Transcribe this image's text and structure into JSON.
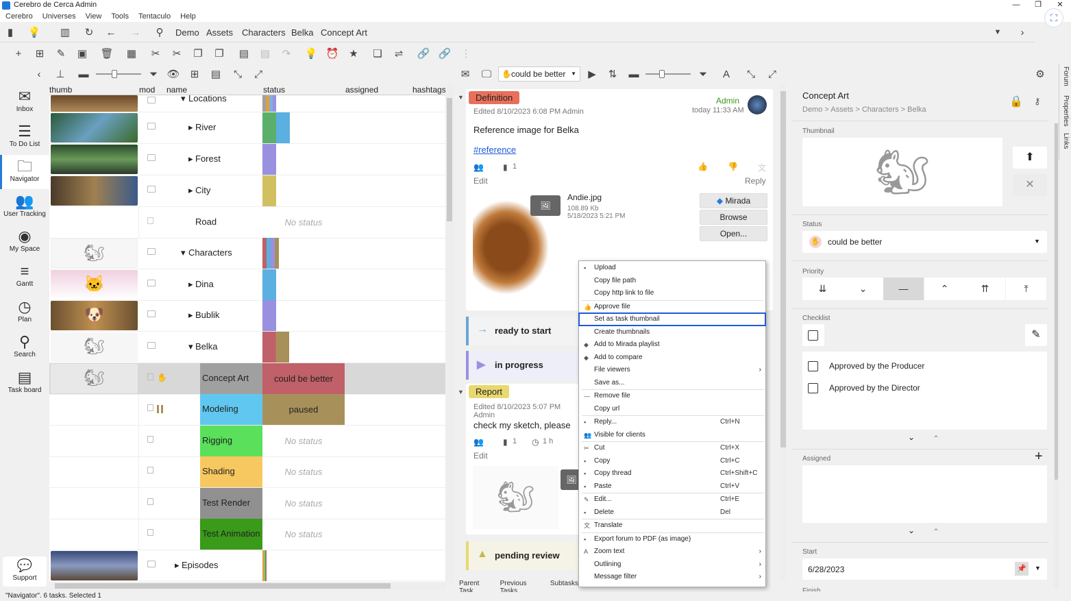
{
  "window": {
    "title": "Cerebro de Cerca  Admin"
  },
  "menu": [
    "Cerebro",
    "Universes",
    "View",
    "Tools",
    "Tentaculo",
    "Help"
  ],
  "breadcrumb": [
    "Demo",
    "Assets",
    "Characters",
    "Belka",
    "Concept Art"
  ],
  "nav": [
    {
      "label": "Inbox",
      "icon": "inbox-icon",
      "glyph": "✉"
    },
    {
      "label": "To Do List",
      "icon": "list-icon",
      "glyph": "☰"
    },
    {
      "label": "Navigator",
      "icon": "folder-icon",
      "glyph": "🗀"
    },
    {
      "label": "User Tracking",
      "icon": "users-icon",
      "glyph": "👥"
    },
    {
      "label": "My Space",
      "icon": "globe-icon",
      "glyph": "◉"
    },
    {
      "label": "Gantt",
      "icon": "gantt-icon",
      "glyph": "≡"
    },
    {
      "label": "Plan",
      "icon": "plan-icon",
      "glyph": "◷"
    },
    {
      "label": "Search",
      "icon": "search-icon",
      "glyph": "⚲"
    },
    {
      "label": "Task board",
      "icon": "clipboard-icon",
      "glyph": "▤"
    }
  ],
  "support": "Support",
  "columns": [
    "thumb",
    "mod",
    "name",
    "status",
    "assigned",
    "hashtags"
  ],
  "rows": [
    {
      "name": "Locations",
      "arrow": "▾",
      "status": "",
      "thumb": "#a08050"
    },
    {
      "name": "River",
      "arrow": "▸",
      "status": "",
      "thumb": "#4a8a6a"
    },
    {
      "name": "Forest",
      "arrow": "▸",
      "status": "",
      "thumb": "#3a6a3a"
    },
    {
      "name": "City",
      "arrow": "▸",
      "status": "",
      "thumb": "#6a5a3a"
    },
    {
      "name": "Road",
      "arrow": "",
      "status": "No status",
      "thumb": ""
    },
    {
      "name": "Characters",
      "arrow": "▾",
      "status": "",
      "thumb": "#d8d8d8"
    },
    {
      "name": "Dina",
      "arrow": "▸",
      "status": "",
      "thumb": "#e8c0d0"
    },
    {
      "name": "Bublik",
      "arrow": "▸",
      "status": "",
      "thumb": "#8a6a3a"
    },
    {
      "name": "Belka",
      "arrow": "▾",
      "status": "",
      "thumb": "#d8d8d8"
    },
    {
      "name": "Concept Art",
      "arrow": "",
      "status": "could be better",
      "thumb": "#d0d0d0"
    },
    {
      "name": "Modeling",
      "arrow": "",
      "status": "paused",
      "thumb": ""
    },
    {
      "name": "Rigging",
      "arrow": "",
      "status": "No status",
      "thumb": ""
    },
    {
      "name": "Shading",
      "arrow": "",
      "status": "No status",
      "thumb": ""
    },
    {
      "name": "Test Render",
      "arrow": "",
      "status": "No status",
      "thumb": ""
    },
    {
      "name": "Test Animation",
      "arrow": "",
      "status": "No status",
      "thumb": ""
    },
    {
      "name": "Episodes",
      "arrow": "▸",
      "status": "",
      "thumb": "#5a6a8a"
    }
  ],
  "forum_toolbar": {
    "status": "could be better"
  },
  "definition": {
    "tag": "Definition",
    "author": "Admin",
    "time": "today 11:33 AM",
    "edited": "Edited 8/10/2023 6:08 PM  Admin",
    "text": "Reference image for Belka",
    "hashtag": "#reference",
    "files_count": "1",
    "edit": "Edit",
    "reply": "Reply",
    "file": {
      "name": "Andie.jpg",
      "size": "108.89 Kb",
      "date": "5/18/2023 5:21 PM"
    },
    "buttons": [
      "Mirada",
      "Browse",
      "Open..."
    ]
  },
  "status_cards": [
    "ready to start",
    "in progress",
    "pending review"
  ],
  "report": {
    "tag": "Report",
    "edited": "Edited 8/10/2023 5:07 PM  Admin",
    "text": "check my sketch, please",
    "files_count": "1",
    "time_spent": "1 h",
    "edit": "Edit"
  },
  "bottom_tabs": [
    "Parent Task",
    "Previous Tasks",
    "Subtasks"
  ],
  "context_menu": [
    {
      "label": "Upload",
      "shortcut": "",
      "icon": "▪"
    },
    {
      "label": "Copy file path",
      "shortcut": ""
    },
    {
      "label": "Copy http link to file",
      "shortcut": ""
    },
    {
      "sep": true
    },
    {
      "label": "Approve file",
      "shortcut": "",
      "icon": "👍"
    },
    {
      "label": "Set as task thumbnail",
      "shortcut": "",
      "highlight": true
    },
    {
      "label": "Create thumbnails",
      "shortcut": ""
    },
    {
      "label": "Add to Mirada playlist",
      "shortcut": "",
      "icon": "◆"
    },
    {
      "label": "Add to compare",
      "shortcut": "",
      "icon": "◆"
    },
    {
      "label": "File viewers",
      "shortcut": "",
      "submenu": true
    },
    {
      "label": "Save as...",
      "shortcut": ""
    },
    {
      "sep": true
    },
    {
      "label": "Remove file",
      "shortcut": "",
      "icon": "—"
    },
    {
      "label": "Copy url",
      "shortcut": ""
    },
    {
      "sep": true
    },
    {
      "label": "Reply...",
      "shortcut": "Ctrl+N",
      "icon": "▪"
    },
    {
      "label": "Visible for clients",
      "shortcut": "",
      "icon": "👥"
    },
    {
      "sep": true
    },
    {
      "label": "Cut",
      "shortcut": "Ctrl+X",
      "icon": "✂"
    },
    {
      "label": "Copy",
      "shortcut": "Ctrl+C",
      "icon": "▪"
    },
    {
      "label": "Copy thread",
      "shortcut": "Ctrl+Shift+C",
      "icon": "▪"
    },
    {
      "label": "Paste",
      "shortcut": "Ctrl+V",
      "icon": "▪"
    },
    {
      "sep": true
    },
    {
      "label": "Edit...",
      "shortcut": "Ctrl+E",
      "icon": "✎"
    },
    {
      "label": "Delete",
      "shortcut": "Del",
      "icon": "▪"
    },
    {
      "sep": true
    },
    {
      "label": "Translate",
      "shortcut": "",
      "icon": "文"
    },
    {
      "sep": true
    },
    {
      "label": "Export forum to PDF (as image)",
      "shortcut": "",
      "icon": "▪"
    },
    {
      "label": "Zoom text",
      "shortcut": "",
      "icon": "A",
      "submenu": true
    },
    {
      "label": "Outlining",
      "shortcut": "",
      "submenu": true
    },
    {
      "label": "Message filter",
      "shortcut": "",
      "submenu": true
    }
  ],
  "properties": {
    "title": "Concept Art",
    "path": "Demo > Assets > Characters > Belka",
    "thumbnail_label": "Thumbnail",
    "status_label": "Status",
    "status_value": "could be better",
    "priority_label": "Priority",
    "checklist_label": "Checklist",
    "checklist_items": [
      "Approved by the Producer",
      "Approved by the Director"
    ],
    "assigned_label": "Assigned",
    "start_label": "Start",
    "start_value": "6/28/2023",
    "finish_label": "Finish"
  },
  "side_tabs": [
    "Forum",
    "Properties",
    "Links"
  ],
  "statusbar": "\"Navigator\". 6 tasks. Selected 1",
  "colors": {
    "accent": "#2a7ad8",
    "definition_tag": "#e8705a",
    "report_tag": "#e8d870",
    "could_be_better": "#c06068",
    "paused": "#a8905a",
    "modeling": "#60c8f0",
    "rigging": "#5ae05a",
    "shading": "#f8c860",
    "test_render": "#909090",
    "test_animation": "#3a9a1a",
    "concept_art": "#a0a0a0"
  }
}
